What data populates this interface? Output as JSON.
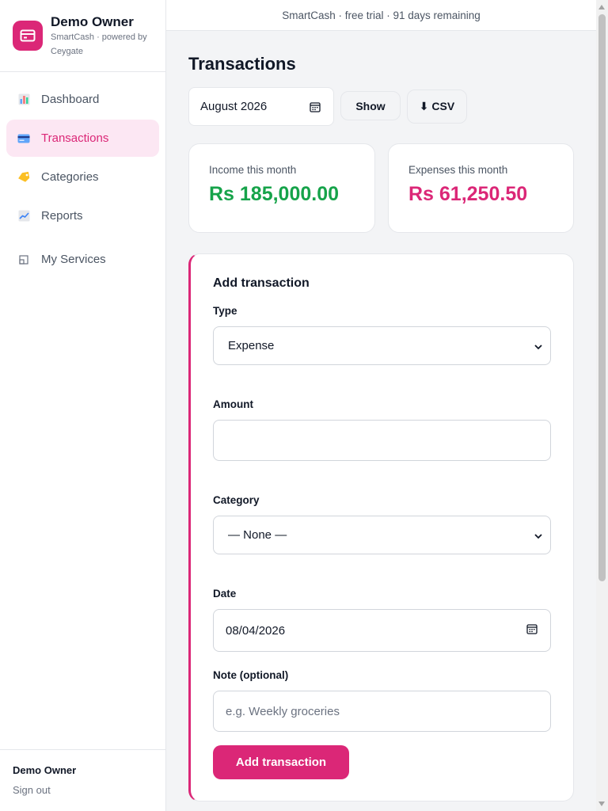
{
  "brand": {
    "name": "Demo Owner",
    "subtitle": "SmartCash · powered by Ceygate",
    "accent": "#db2777"
  },
  "sidebar": {
    "items": [
      {
        "label": "Dashboard",
        "icon": "bar-chart-icon",
        "active": false
      },
      {
        "label": "Transactions",
        "icon": "credit-card-icon",
        "active": true
      },
      {
        "label": "Categories",
        "icon": "tag-icon",
        "active": false
      },
      {
        "label": "Reports",
        "icon": "line-chart-icon",
        "active": false
      },
      {
        "label": "My Services",
        "icon": "window-icon",
        "active": false
      }
    ],
    "footer": {
      "user": "Demo Owner",
      "signout": "Sign out"
    }
  },
  "topbar": {
    "text": "SmartCash · free trial · 91 days remaining"
  },
  "page": {
    "title": "Transactions",
    "month_value": "August 2026",
    "show_label": "Show",
    "csv_label": "⬇ CSV"
  },
  "stats": {
    "income_label": "Income this month",
    "income_value": "Rs 185,000.00",
    "income_color": "#16a34a",
    "expense_label": "Expenses this month",
    "expense_value": "Rs 61,250.50",
    "expense_color": "#db2777"
  },
  "form": {
    "title": "Add transaction",
    "type_label": "Type",
    "type_value": "Expense",
    "amount_label": "Amount",
    "amount_value": "",
    "category_label": "Category",
    "category_value": "— None —",
    "date_label": "Date",
    "date_value": "08/04/2026",
    "note_label": "Note (optional)",
    "note_placeholder": "e.g. Weekly groceries",
    "submit_label": "Add transaction"
  }
}
